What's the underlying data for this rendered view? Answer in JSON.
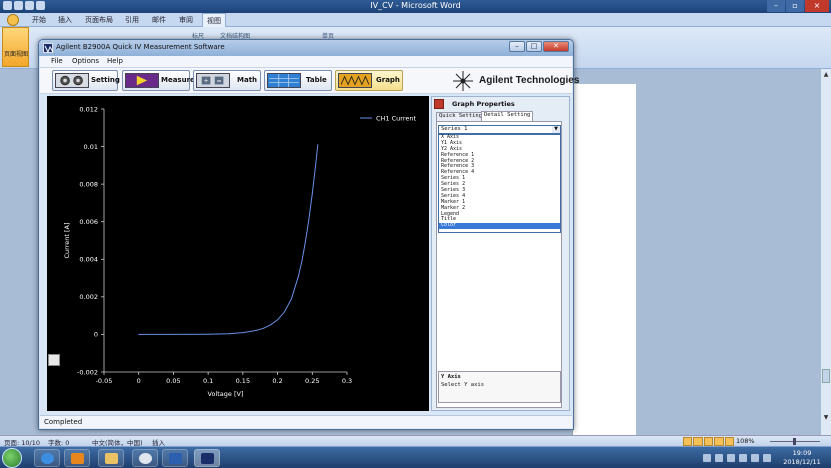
{
  "word": {
    "title": "IV_CV - Microsoft Word",
    "tabs": [
      "开始",
      "插入",
      "页面布局",
      "引用",
      "邮件",
      "审阅",
      "视图"
    ],
    "active_tab": "视图",
    "ribbon_big_label": "页面视图",
    "ribbon_faint": [
      "标尺",
      "文档结构图",
      "单页"
    ],
    "status": {
      "page": "页面: 10/10",
      "words": "字数: 0",
      "lang": "中文(简体，中国)",
      "mode": "插入",
      "zoom": "108%"
    }
  },
  "taskbar": {
    "time": "19:09",
    "date": "2018/12/11"
  },
  "app": {
    "title": "Agilent B2900A Quick IV Measurement Software",
    "menu": [
      "File",
      "Options",
      "Help"
    ],
    "toolbar": {
      "setting": "Setting",
      "measure": "Measure",
      "math": "Math",
      "table": "Table",
      "graph": "Graph"
    },
    "brand": "Agilent Technologies",
    "status": "Completed"
  },
  "graph_properties": {
    "header": "Graph Properties",
    "tabs": [
      "Quick Setting",
      "Detail Setting"
    ],
    "selected_tab": "Detail Setting",
    "combo_value": "Series 1",
    "list_items": [
      "X Axis",
      "Y1 Axis",
      "Y2 Axis",
      "Reference 1",
      "Reference 2",
      "Reference 3",
      "Reference 4",
      "Series 1",
      "Series 2",
      "Series 3",
      "Series 4",
      "Marker 1",
      "Marker 2",
      "Legend",
      "Title",
      "Color"
    ],
    "selected_item": "Color",
    "desc_title": "Y Axis",
    "desc_text": "Select Y axis"
  },
  "colors": {
    "plot_bg": "#000000",
    "series": "#6a8fe8",
    "selection": "#3a78d8"
  },
  "chart_data": {
    "type": "line",
    "xlabel": "Voltage [V]",
    "ylabel": "Current [A]",
    "xlim": [
      -0.05,
      0.3
    ],
    "ylim": [
      -0.002,
      0.012
    ],
    "xticks": [
      "-0.05",
      "0",
      "0.05",
      "0.1",
      "0.15",
      "0.2",
      "0.25",
      "0.3"
    ],
    "yticks": [
      "-0.002",
      "0",
      "0.002",
      "0.004",
      "0.006",
      "0.008",
      "0.01",
      "0.012"
    ],
    "series": [
      {
        "name": "CH1 Current",
        "x": [
          0,
          0.05,
          0.1,
          0.13,
          0.15,
          0.17,
          0.18,
          0.19,
          0.2,
          0.21,
          0.22,
          0.23,
          0.235,
          0.24,
          0.245,
          0.25,
          0.255,
          0.258
        ],
        "y": [
          0,
          0,
          1e-05,
          4e-05,
          0.0001,
          0.00022,
          0.00033,
          0.00051,
          0.00078,
          0.0012,
          0.0019,
          0.0031,
          0.0039,
          0.0049,
          0.0061,
          0.0075,
          0.0091,
          0.0101
        ]
      }
    ],
    "legend": "top-right",
    "grid": false
  }
}
